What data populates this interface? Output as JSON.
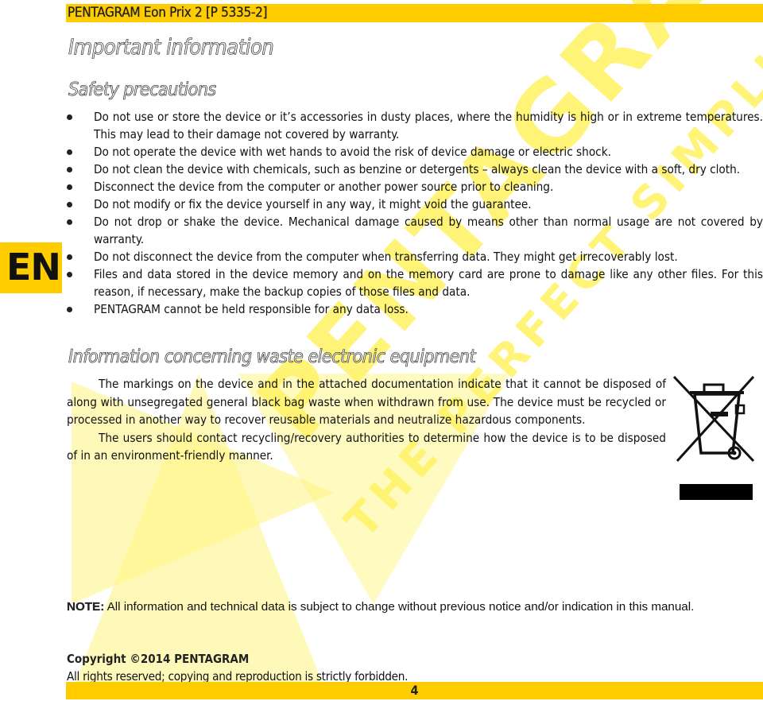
{
  "header": {
    "title": "PENTAGRAM Eon Prix 2 [P 5335-2]"
  },
  "language_tab": "EN",
  "watermark": {
    "brand": "PENTAGRAM",
    "slogan": "THE PERFECT SIMPLICITY",
    "color": "#fff200"
  },
  "main_title": "Important information",
  "safety": {
    "heading": "Safety precautions",
    "items": [
      "Do not use or store the device or it’s accessories in dusty places, where the humidity is high or in extreme temperatures. This may lead to their damage not covered by warranty.",
      "Do not operate the device with wet hands to avoid the risk of device damage or electric shock.",
      "Do not clean the device with chemicals, such as benzine or detergents – always clean the device with a soft, dry cloth.",
      "Disconnect the device from the computer or another power source prior to cleaning.",
      "Do not modify or fix the device yourself in any way, it might void the guarantee.",
      "Do not drop or shake the device. Mechanical damage caused by means other than normal usage are not covered by warranty.",
      "Do not disconnect the device from the computer when transferring data. They might get irrecoverably lost.",
      "Files and data stored in the device memory and on the memory card are prone to damage like any other files. For this reason, if necessary, make the backup copies of those files and data.",
      "PENTAGRAM cannot be held responsible for any data loss."
    ]
  },
  "waste": {
    "heading": "Information concerning waste electronic equipment",
    "paragraphs": [
      "The markings on the device and in the attached documentation indicate that it cannot be disposed of along with unsegregated general black bag waste when withdrawn from use. The device must be recycled or processed in another way to recover reusable materials and neutralize hazardous components.",
      "The users should contact recycling/recovery authorities to determine how the device is to be disposed of in an environment-friendly manner."
    ],
    "icon": "crossed-out-wheelie-bin-icon"
  },
  "note": {
    "label": "NOTE:",
    "text": " All information and technical data is subject to change without previous notice and/or indication in this manual."
  },
  "copyright": "Copyright ©2014 PENTAGRAM",
  "rights": "All rights reserved; copying and reproduction is strictly forbidden.",
  "page_number": "4"
}
